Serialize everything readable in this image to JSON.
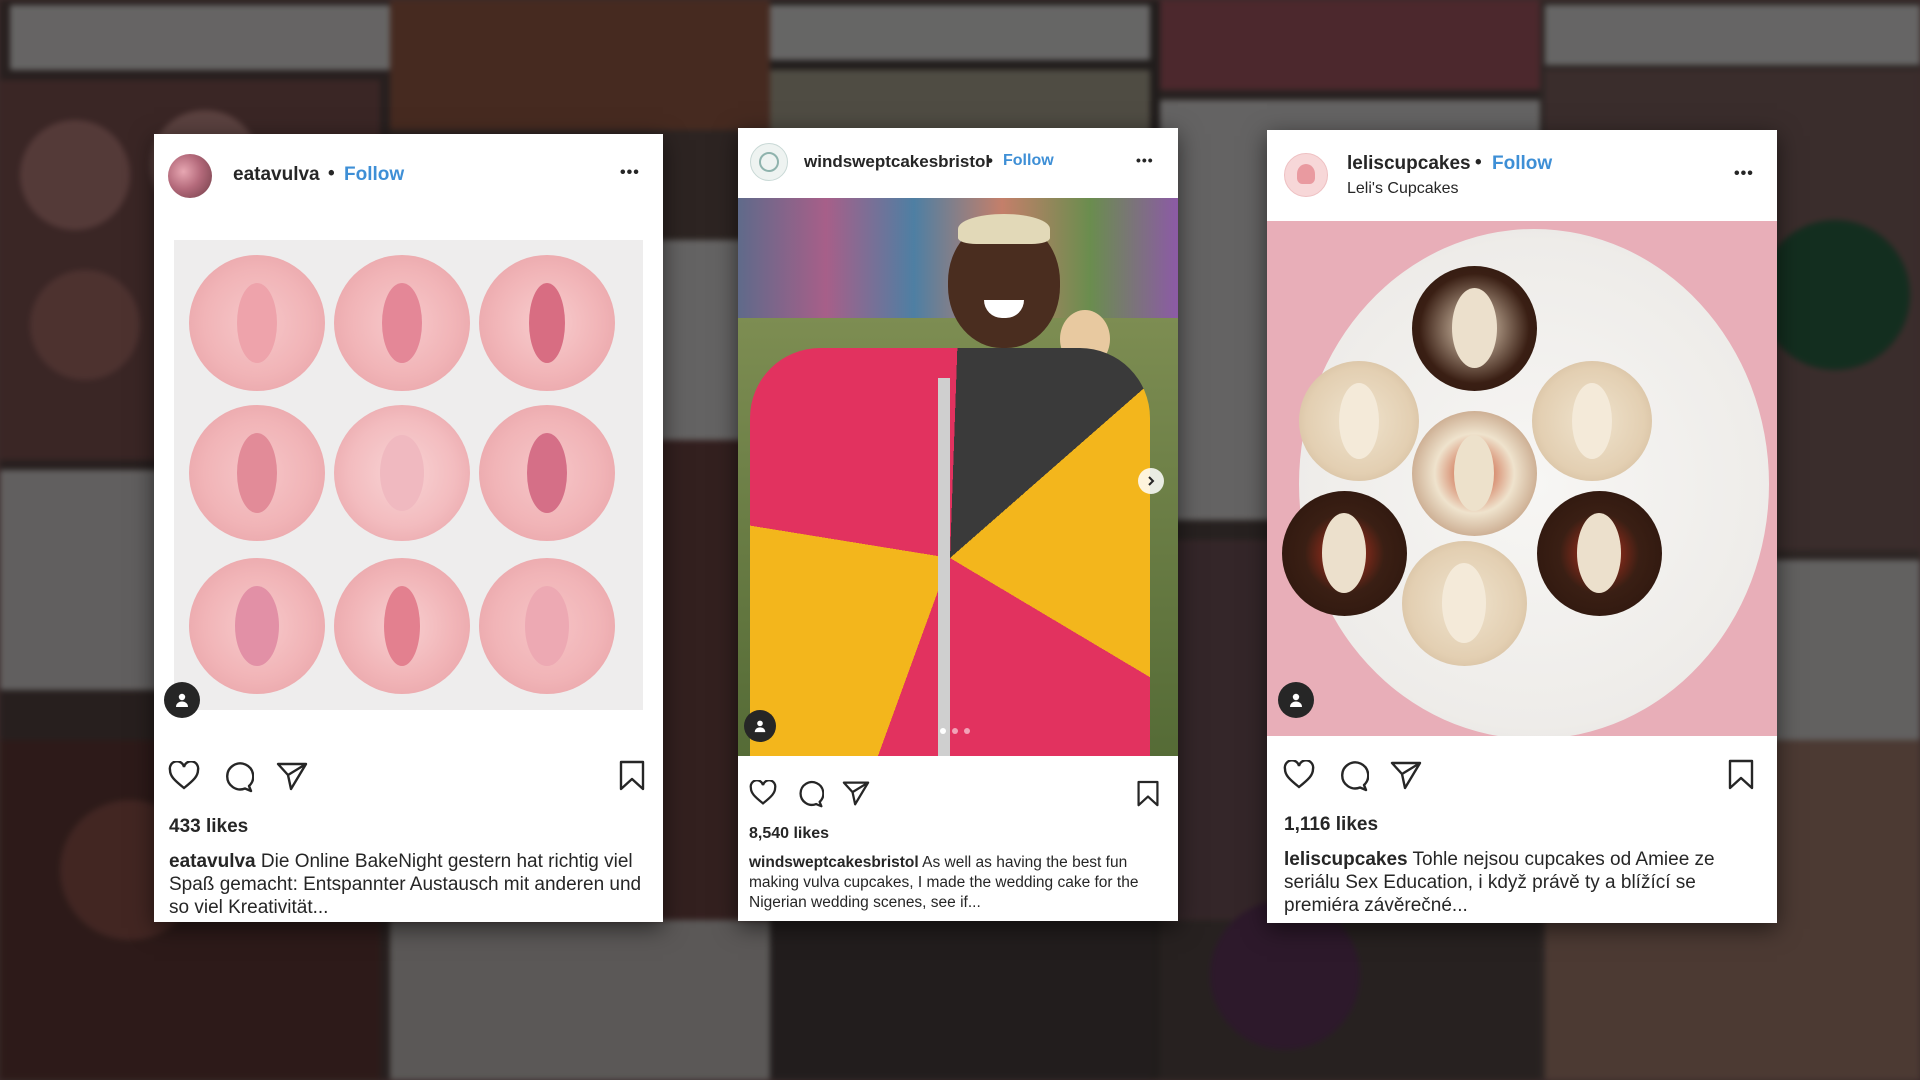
{
  "posts": [
    {
      "username": "eatavulva",
      "follow_label": "Follow",
      "subline": "",
      "likes": "433 likes",
      "caption_user": "eatavulva",
      "caption_text": "Die Online BakeNight gestern hat richtig viel Spaß gemacht: Entspannter Austausch mit anderen und so viel Kreativität...",
      "more_label": "•••"
    },
    {
      "username": "windsweptcakesbristol",
      "follow_label": "Follow",
      "subline": "",
      "likes": "8,540 likes",
      "caption_user": "windsweptcakesbristol",
      "caption_text": "As well as having the best fun making vulva cupcakes, I made the wedding cake for the Nigerian wedding scenes, see if...",
      "more_label": "•••"
    },
    {
      "username": "leliscupcakes",
      "follow_label": "Follow",
      "subline": "Leli's Cupcakes",
      "likes": "1,116 likes",
      "caption_user": "leliscupcakes",
      "caption_text": "Tohle nejsou cupcakes od Amiee ze seriálu Sex Education, i když právě ty a blížící se premiéra závěrečné...",
      "more_label": "•••"
    }
  ],
  "icons": [
    "heart-icon",
    "comment-icon",
    "share-icon",
    "bookmark-icon",
    "user-tag-icon",
    "chevron-right-icon",
    "more-icon"
  ],
  "colors": {
    "follow": "#3e8fd6",
    "text": "#262626",
    "card": "#ffffff"
  }
}
